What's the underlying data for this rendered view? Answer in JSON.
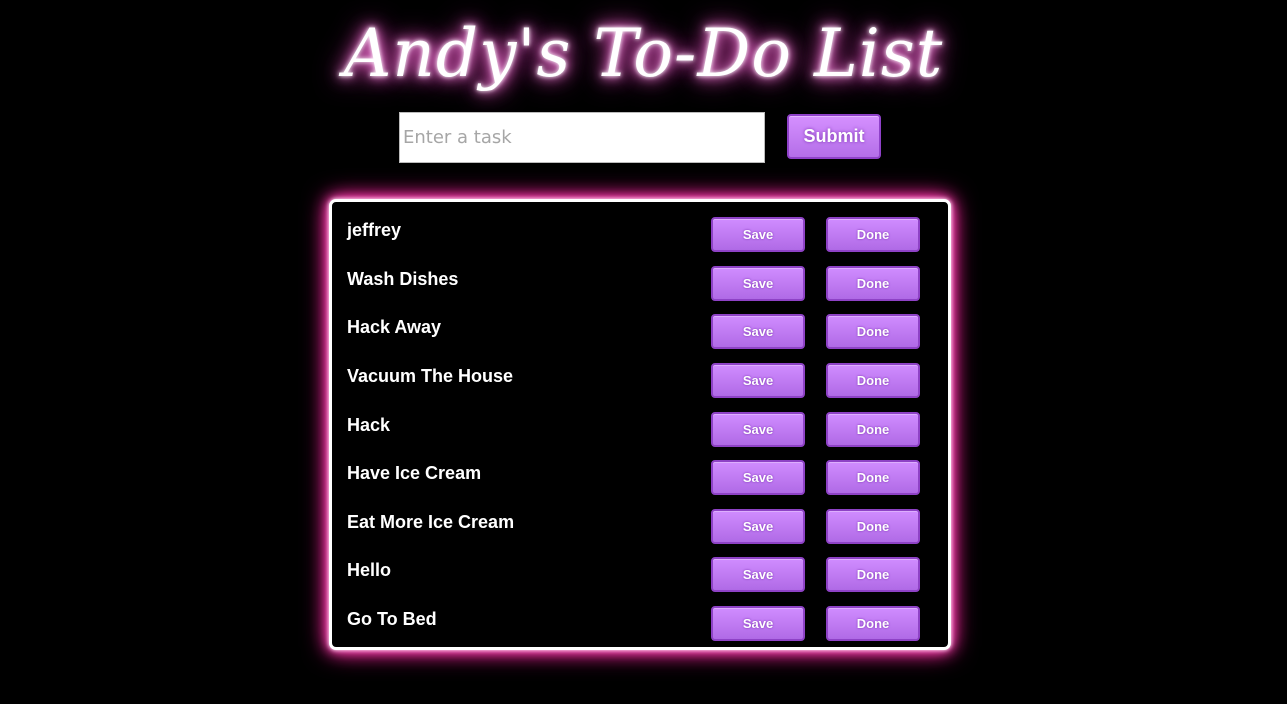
{
  "header": {
    "title": "Andy's To-Do List"
  },
  "form": {
    "task_placeholder": "Enter a task",
    "task_value": "",
    "submit_label": "Submit"
  },
  "tasks": [
    {
      "text": "jeffrey",
      "save_label": "Save",
      "done_label": "Done"
    },
    {
      "text": "Wash Dishes",
      "save_label": "Save",
      "done_label": "Done"
    },
    {
      "text": "Hack Away",
      "save_label": "Save",
      "done_label": "Done"
    },
    {
      "text": "Vacuum The House",
      "save_label": "Save",
      "done_label": "Done"
    },
    {
      "text": "Hack",
      "save_label": "Save",
      "done_label": "Done"
    },
    {
      "text": "Have Ice Cream",
      "save_label": "Save",
      "done_label": "Done"
    },
    {
      "text": "Eat More Ice Cream",
      "save_label": "Save",
      "done_label": "Done"
    },
    {
      "text": "Hello",
      "save_label": "Save",
      "done_label": "Done"
    },
    {
      "text": "Go To Bed",
      "save_label": "Save",
      "done_label": "Done"
    }
  ],
  "colors": {
    "background": "#000000",
    "button_fill": "#c27cf5",
    "button_border": "#8e42c6",
    "panel_glow": "#ff2fa8",
    "title_glow": "#ff5fd6",
    "text": "#ffffff"
  }
}
